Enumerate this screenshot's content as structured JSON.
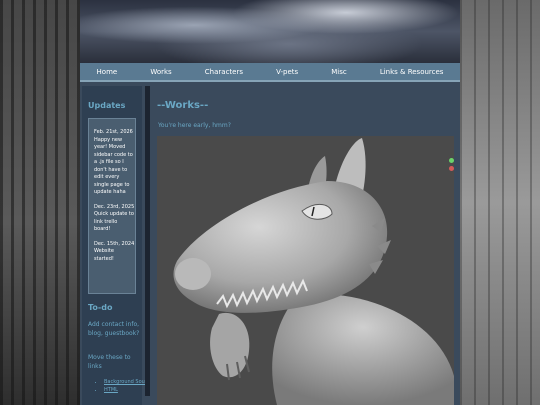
{
  "nav": {
    "items": [
      "Home",
      "Works",
      "Characters",
      "V-pets",
      "Misc",
      "Links & Resources"
    ]
  },
  "sidebar": {
    "updates_title": "Updates",
    "updates": [
      {
        "date": "Feb. 21st, 2026",
        "text": "Happy new year! Moved sidebar code to a .js file so I don't have to edit every single page to update haha"
      },
      {
        "date": "Dec. 23rd, 2025",
        "text": "Quick update to link trello board!"
      },
      {
        "date": "Dec. 15th, 2024",
        "text": "Website started!"
      }
    ],
    "todo_title": "To-do",
    "todo_items": [
      "Add contact info, blog, guestbook?",
      "Move these to links"
    ],
    "todo_links": [
      "Background Source",
      "HTML"
    ]
  },
  "main": {
    "title": "--Works--",
    "subtitle": "You're here early, hmm?"
  },
  "colors": {
    "accent": "#6aa7c4",
    "nav_bg": "#5a7a92",
    "panel_bg": "#3a4a5c",
    "sidebar_bg": "#2e3f52",
    "box_bg": "#4a5e70"
  }
}
